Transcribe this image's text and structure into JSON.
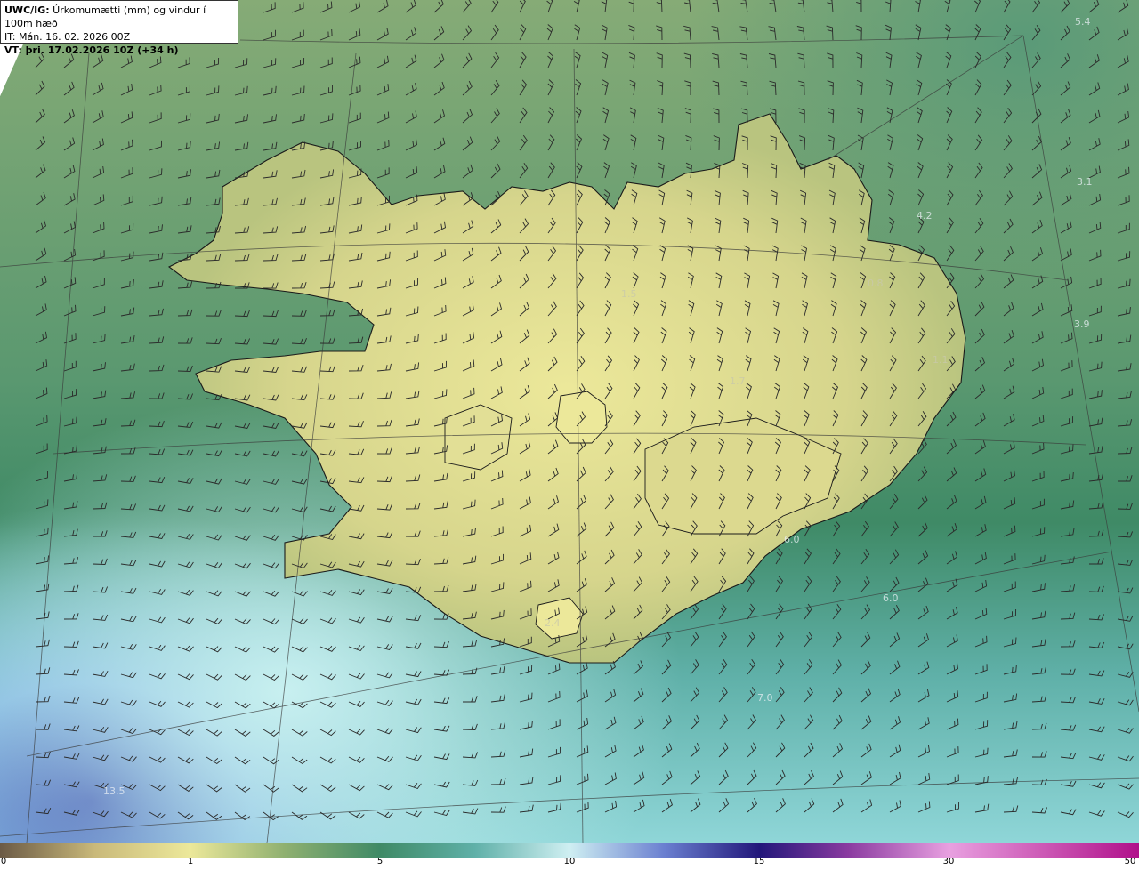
{
  "header": {
    "line1_bold": "UWC/IG:",
    "line1_rest": " Úrkomumætti (mm) og vindur í 100m hæð",
    "line2": "IT: Mán. 16. 02. 2026 00Z",
    "line3": "VT: þri. 17.02.2026 10Z (+34 h)"
  },
  "map_values": [
    {
      "label": "5.4"
    },
    {
      "label": "3.1"
    },
    {
      "label": "4.2"
    },
    {
      "label": "3.9"
    },
    {
      "label": "6.0"
    },
    {
      "label": "6.0"
    },
    {
      "label": "7.0"
    },
    {
      "label": "13.5"
    },
    {
      "label": "1.7"
    },
    {
      "label": "1.5"
    },
    {
      "label": "0.8"
    },
    {
      "label": "1.1"
    },
    {
      "label": "2.4"
    }
  ],
  "legend": {
    "ticks": [
      "0",
      "1",
      "5",
      "10",
      "15",
      "30",
      "50"
    ],
    "stops": [
      {
        "value": 0,
        "color": "#6b5a45"
      },
      {
        "value": 0.5,
        "color": "#c9b97a"
      },
      {
        "value": 1,
        "color": "#ece89a"
      },
      {
        "value": 3,
        "color": "#8fb070"
      },
      {
        "value": 5,
        "color": "#3f8a66"
      },
      {
        "value": 7.5,
        "color": "#5fb0a8"
      },
      {
        "value": 10,
        "color": "#cfeff2"
      },
      {
        "value": 12.5,
        "color": "#6a7fd0"
      },
      {
        "value": 15,
        "color": "#22177a"
      },
      {
        "value": 22,
        "color": "#8a3aa0"
      },
      {
        "value": 30,
        "color": "#e8a0e0"
      },
      {
        "value": 50,
        "color": "#b0108a"
      }
    ]
  },
  "colors": {
    "land": "#dcd98f",
    "sea_north": "#7ea874",
    "sea_mid": "#4d9070",
    "sea_south": "#6fb8b0",
    "sea_deep_south": "#4a6ab8"
  }
}
